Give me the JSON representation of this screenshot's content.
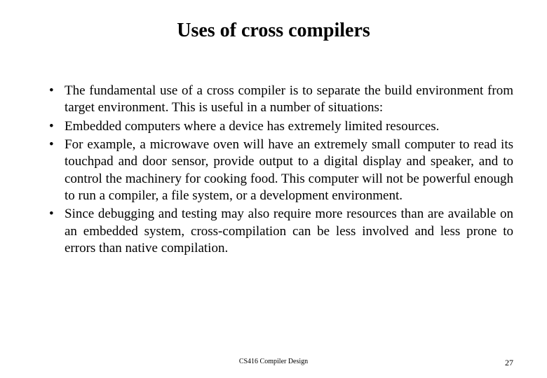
{
  "slide": {
    "title": "Uses of cross compilers",
    "bullets": [
      "The fundamental use of a cross compiler is to separate the build environment from target environment. This is useful in a number of situations:",
      "Embedded computers where a device has extremely limited resources.",
      "For example, a microwave oven will have an extremely small computer to read its touchpad and door sensor, provide output to a digital display and speaker, and to control the machinery for cooking food. This computer will not be powerful enough to run a compiler, a file system, or a development environment.",
      "Since debugging and testing may also require more resources than are available on an embedded system, cross-compilation can be less involved and less prone to errors than native compilation."
    ],
    "footer": {
      "course": "CS416 Compiler Design",
      "page": "27"
    }
  }
}
